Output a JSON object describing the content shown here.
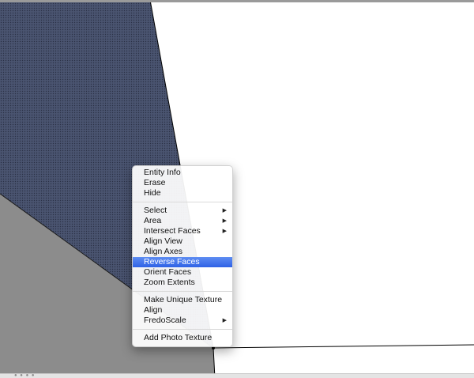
{
  "context_menu": {
    "groups": [
      {
        "items": [
          {
            "label": "Entity Info"
          },
          {
            "label": "Erase"
          },
          {
            "label": "Hide"
          }
        ]
      },
      {
        "items": [
          {
            "label": "Select",
            "submenu": true
          },
          {
            "label": "Area",
            "submenu": true
          },
          {
            "label": "Intersect Faces",
            "submenu": true
          },
          {
            "label": "Align View"
          },
          {
            "label": "Align Axes"
          },
          {
            "label": "Reverse Faces",
            "highlighted": true
          },
          {
            "label": "Orient Faces"
          },
          {
            "label": "Zoom Extents"
          }
        ]
      },
      {
        "items": [
          {
            "label": "Make Unique Texture"
          },
          {
            "label": "Align"
          },
          {
            "label": "FredoScale",
            "submenu": true
          }
        ]
      },
      {
        "items": [
          {
            "label": "Add Photo Texture"
          }
        ]
      }
    ],
    "submenu_arrow_glyph": "▶",
    "highlight_color": "#3d6fea"
  },
  "viewport": {
    "selected_face_color": "#4a5470",
    "gray_face_color": "#8c8c8c",
    "background_color": "#ffffff"
  }
}
